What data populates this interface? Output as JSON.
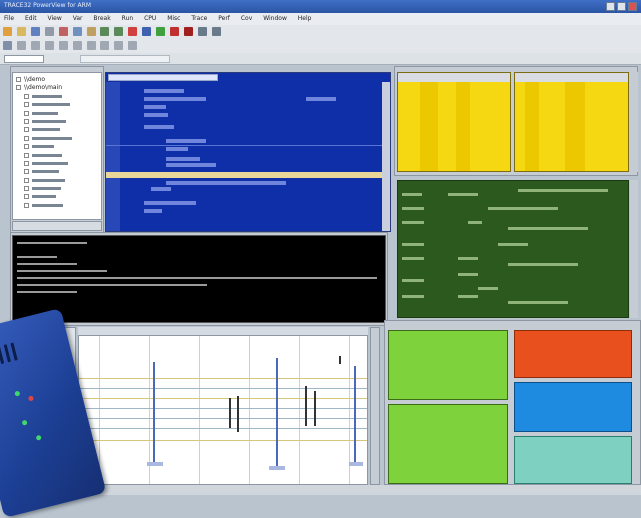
{
  "window": {
    "title": "TRACE32 PowerView for ARM",
    "controls": [
      "minimize",
      "maximize",
      "close"
    ]
  },
  "menubar": {
    "items": [
      "File",
      "Edit",
      "View",
      "Var",
      "Break",
      "Run",
      "CPU",
      "Misc",
      "Trace",
      "Perf",
      "Cov",
      "Window",
      "Help"
    ]
  },
  "toolbar": {
    "buttons": [
      "new-icon",
      "open-icon",
      "save-icon",
      "print-icon",
      "cut-icon",
      "copy-icon",
      "paste-icon",
      "undo-icon",
      "redo-icon",
      "step-icon",
      "over-icon",
      "go-icon",
      "break-icon",
      "stop-icon",
      "up-icon",
      "down-icon",
      "reset-icon",
      "list-icon",
      "register-icon",
      "memory-icon",
      "trace-icon"
    ]
  },
  "tree": {
    "rows": [
      "\\\\demo",
      "\\\\demo\\main",
      "",
      "",
      "",
      "",
      "",
      "",
      "",
      "",
      "",
      "",
      "",
      "",
      "",
      "",
      ""
    ]
  },
  "status": {
    "segment": ""
  },
  "colors": {
    "editor_bg": "#0f2fa8",
    "memory_bg": "#f5d712",
    "green_bg": "#2c5a1e",
    "orange": "#e8511d",
    "blue": "#1f8be0",
    "teal": "#7ed0c0",
    "console_bg": "#000000"
  }
}
